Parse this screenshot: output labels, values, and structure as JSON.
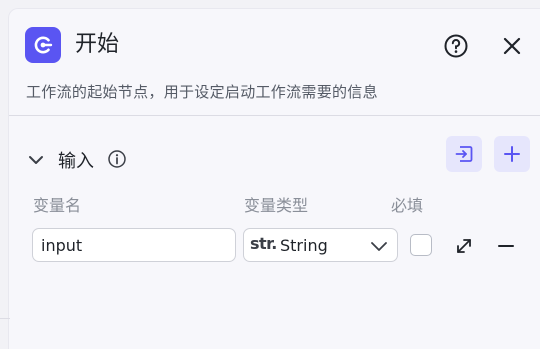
{
  "header": {
    "title": "开始",
    "icon": "start-node-icon",
    "accent_color": "#5a55f2"
  },
  "description": "工作流的起始节点，用于设定启动工作流需要的信息",
  "input_section": {
    "title": "输入",
    "columns": {
      "name": "变量名",
      "type": "变量类型",
      "required": "必填"
    },
    "rows": [
      {
        "name": "input",
        "type_prefix": "str.",
        "type": "String",
        "required": false
      }
    ]
  }
}
